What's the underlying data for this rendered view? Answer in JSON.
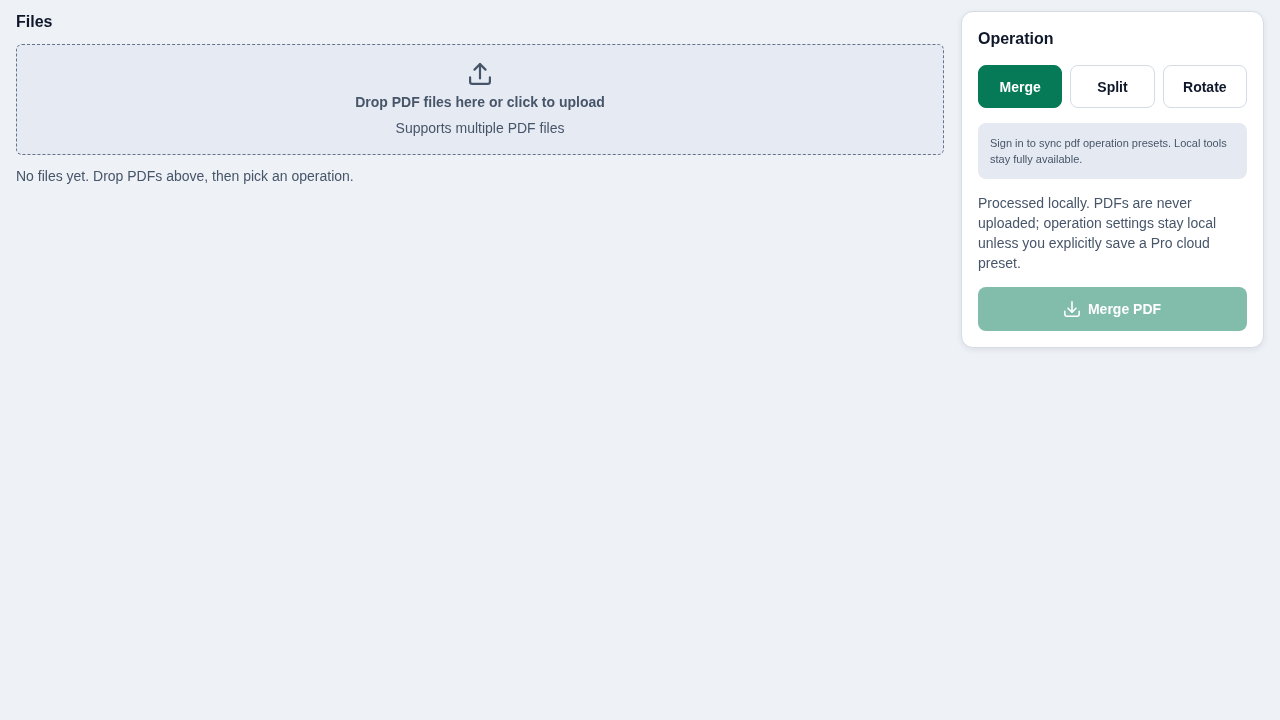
{
  "files": {
    "title": "Files",
    "dropzone": {
      "title": "Drop PDF files here or click to upload",
      "subtitle": "Supports multiple PDF files"
    },
    "empty_message": "No files yet. Drop PDFs above, then pick an operation."
  },
  "operation": {
    "title": "Operation",
    "options": [
      {
        "label": "Merge",
        "selected": true
      },
      {
        "label": "Split",
        "selected": false
      },
      {
        "label": "Rotate",
        "selected": false
      }
    ],
    "notice": "Sign in to sync pdf operation presets. Local tools stay fully available.",
    "privacy_note": "Processed locally. PDFs are never uploaded; operation settings stay local unless you explicitly save a Pro cloud preset.",
    "action_button": {
      "label": "Merge PDF",
      "disabled": true
    }
  }
}
